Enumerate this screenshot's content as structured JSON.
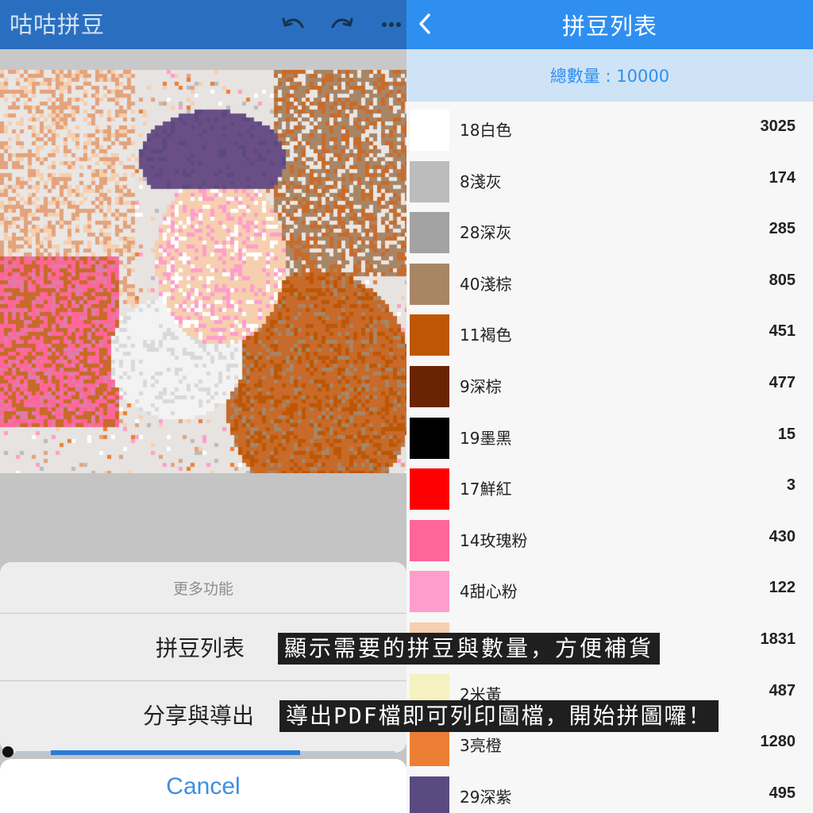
{
  "left_panel": {
    "app_title": "咕咕拼豆",
    "toolbar": {
      "undo_icon": "undo-icon",
      "redo_icon": "redo-icon",
      "more_icon": "more-icon"
    },
    "action_sheet": {
      "title": "更多功能",
      "actions": [
        {
          "label": "拼豆列表"
        },
        {
          "label": "分享與導出"
        }
      ],
      "cancel_label": "Cancel",
      "cancel_color": "#3d8fe0"
    },
    "zoom_slider": {
      "value": 0.68
    }
  },
  "right_panel": {
    "title": "拼豆列表",
    "back_icon": "chevron-left-icon",
    "total_label": "總數量 : 10000",
    "beads": [
      {
        "name": "18白色",
        "count": "3025",
        "color": "#ffffff"
      },
      {
        "name": "8淺灰",
        "count": "174",
        "color": "#bcbcbc"
      },
      {
        "name": "28深灰",
        "count": "285",
        "color": "#a3a3a3"
      },
      {
        "name": "40淺棕",
        "count": "805",
        "color": "#a88565"
      },
      {
        "name": "11褐色",
        "count": "451",
        "color": "#bd5706"
      },
      {
        "name": "9深棕",
        "count": "477",
        "color": "#6b2403"
      },
      {
        "name": "19墨黑",
        "count": "15",
        "color": "#000000"
      },
      {
        "name": "17鮮紅",
        "count": "3",
        "color": "#ff0000"
      },
      {
        "name": "14玫瑰粉",
        "count": "430",
        "color": "#ff6699"
      },
      {
        "name": "4甜心粉",
        "count": "122",
        "color": "#ff9dcc"
      },
      {
        "name": "",
        "count": "1831",
        "color": "#f6cfae"
      },
      {
        "name": "2米黃",
        "count": "487",
        "color": "#f6f1c0"
      },
      {
        "name": "3亮橙",
        "count": "1280",
        "color": "#ec7f33"
      },
      {
        "name": "29深紫",
        "count": "495",
        "color": "#5b4a80"
      }
    ]
  },
  "captions": {
    "first": "顯示需要的拼豆與數量，方便補貨",
    "second": "導出PDF檔即可列印圖檔，開始拼圖囉！"
  }
}
